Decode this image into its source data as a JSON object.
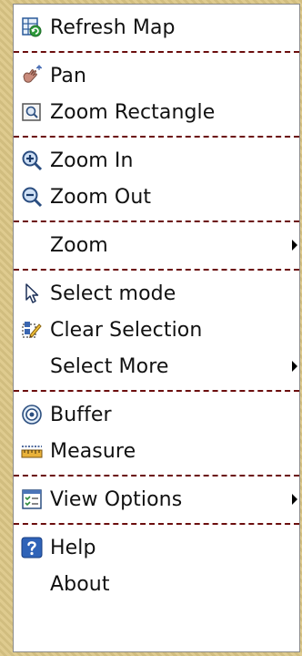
{
  "menu": {
    "refresh": "Refresh Map",
    "pan": "Pan",
    "zoom_rectangle": "Zoom Rectangle",
    "zoom_in": "Zoom In",
    "zoom_out": "Zoom Out",
    "zoom": "Zoom",
    "select_mode": "Select mode",
    "clear_selection": "Clear Selection",
    "select_more": "Select More",
    "buffer": "Buffer",
    "measure": "Measure",
    "view_options": "View Options",
    "help": "Help",
    "about": "About"
  },
  "icons": {
    "refresh": "refresh-map-icon",
    "pan": "pan-hand-icon",
    "zoom_rectangle": "zoom-rectangle-icon",
    "zoom_in": "zoom-in-icon",
    "zoom_out": "zoom-out-icon",
    "select_mode": "select-cursor-icon",
    "clear_selection": "clear-selection-icon",
    "buffer": "buffer-icon",
    "measure": "measure-ruler-icon",
    "view_options": "view-options-icon",
    "help": "help-icon"
  },
  "colors": {
    "separator": "#6b0e0e",
    "background": "#dcc786"
  }
}
